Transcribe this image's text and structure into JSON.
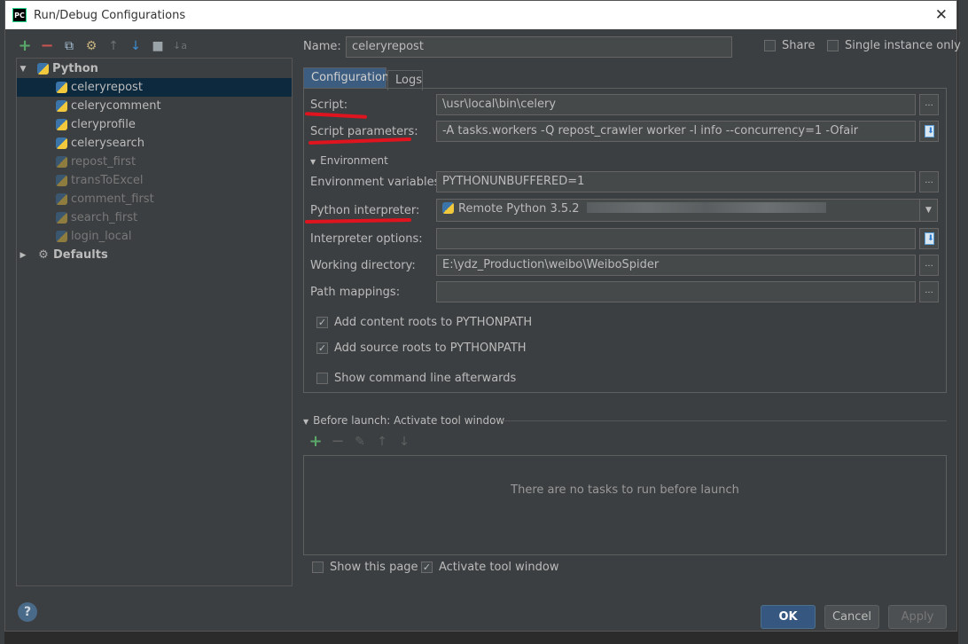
{
  "window": {
    "title": "Run/Debug Configurations",
    "app_badge": "PC"
  },
  "tree": {
    "python_group": "Python",
    "items": [
      {
        "label": "celeryrepost",
        "selected": true,
        "temporary": false
      },
      {
        "label": "celerycomment",
        "selected": false,
        "temporary": false
      },
      {
        "label": "cleryprofile",
        "selected": false,
        "temporary": false
      },
      {
        "label": "celerysearch",
        "selected": false,
        "temporary": false
      },
      {
        "label": "repost_first",
        "selected": false,
        "temporary": true
      },
      {
        "label": "transToExcel",
        "selected": false,
        "temporary": true
      },
      {
        "label": "comment_first",
        "selected": false,
        "temporary": true
      },
      {
        "label": "search_first",
        "selected": false,
        "temporary": true
      },
      {
        "label": "login_local",
        "selected": false,
        "temporary": true
      }
    ],
    "defaults_group": "Defaults"
  },
  "header": {
    "name_label": "Name:",
    "name_value": "celeryrepost",
    "share_label": "Share",
    "single_instance_label": "Single instance only"
  },
  "tabs": [
    {
      "label": "Configuration"
    },
    {
      "label": "Logs"
    }
  ],
  "config": {
    "script_label": "Script:",
    "script_value": "\\usr\\local\\bin\\celery",
    "script_params_label": "Script parameters:",
    "script_params_value": "-A tasks.workers -Q  repost_crawler worker -l info --concurrency=1 -Ofair",
    "environment_section": "Environment",
    "env_vars_label": "Environment variables:",
    "env_vars_value": "PYTHONUNBUFFERED=1",
    "interpreter_label": "Python interpreter:",
    "interpreter_value": "Remote Python 3.5.2",
    "interpreter_options_label": "Interpreter options:",
    "interpreter_options_value": "",
    "working_dir_label": "Working directory:",
    "working_dir_value": "E:\\ydz_Production\\weibo\\WeiboSpider",
    "path_mappings_label": "Path mappings:",
    "path_mappings_value": "",
    "add_content_roots": "Add content roots to PYTHONPATH",
    "add_source_roots": "Add source roots to PYTHONPATH",
    "show_cmdline": "Show command line afterwards",
    "dots": "..."
  },
  "before_launch": {
    "title": "Before launch: Activate tool window",
    "empty_text": "There are no tasks to run before launch",
    "show_page_label": "Show this page",
    "activate_tool_label": "Activate tool window"
  },
  "buttons": {
    "help": "?",
    "ok": "OK",
    "cancel": "Cancel",
    "apply": "Apply"
  },
  "colors": {
    "accent_red": "#e0141e",
    "selection": "#0d293e",
    "primary_button": "#365880"
  }
}
